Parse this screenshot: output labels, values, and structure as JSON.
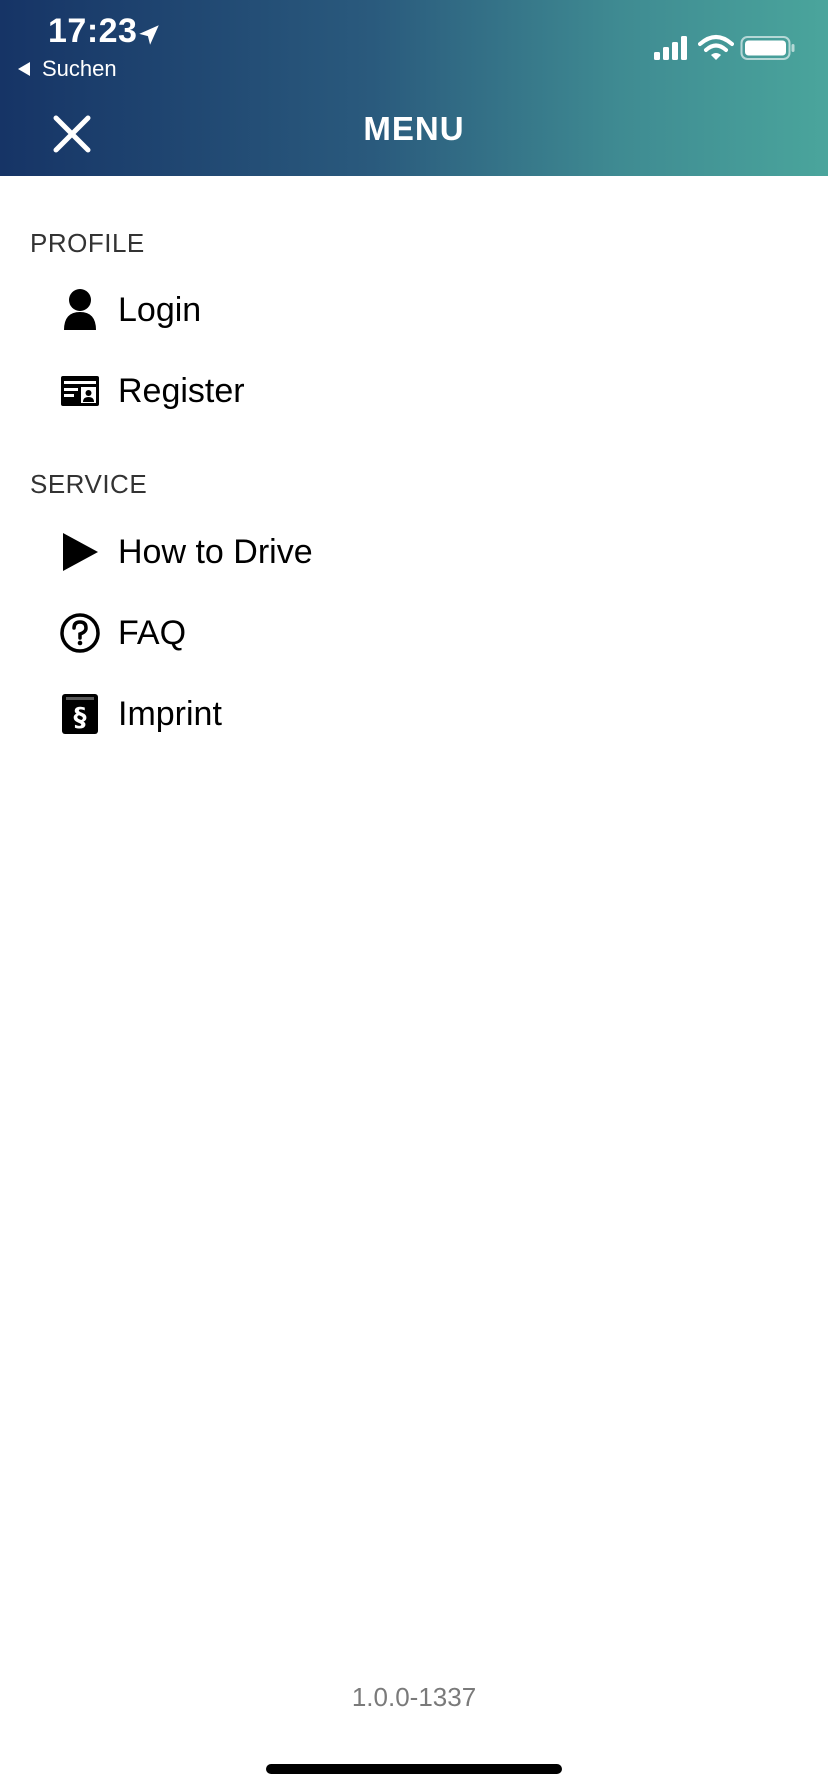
{
  "status_bar": {
    "time": "17:23",
    "back_label": "Suchen"
  },
  "header": {
    "title": "MENU",
    "close_icon": "close-icon"
  },
  "sections": [
    {
      "label": "PROFILE",
      "items": [
        {
          "label": "Login",
          "icon": "user-icon"
        },
        {
          "label": "Register",
          "icon": "id-card-icon"
        }
      ]
    },
    {
      "label": "SERVICE",
      "items": [
        {
          "label": "How to Drive",
          "icon": "play-icon"
        },
        {
          "label": "FAQ",
          "icon": "question-icon"
        },
        {
          "label": "Imprint",
          "icon": "paragraph-icon"
        }
      ]
    }
  ],
  "footer": {
    "version": "1.0.0-1337"
  },
  "colors": {
    "header_gradient_start": "#163466",
    "header_gradient_end": "#4aa59c",
    "version_text": "#7a7a7a"
  }
}
